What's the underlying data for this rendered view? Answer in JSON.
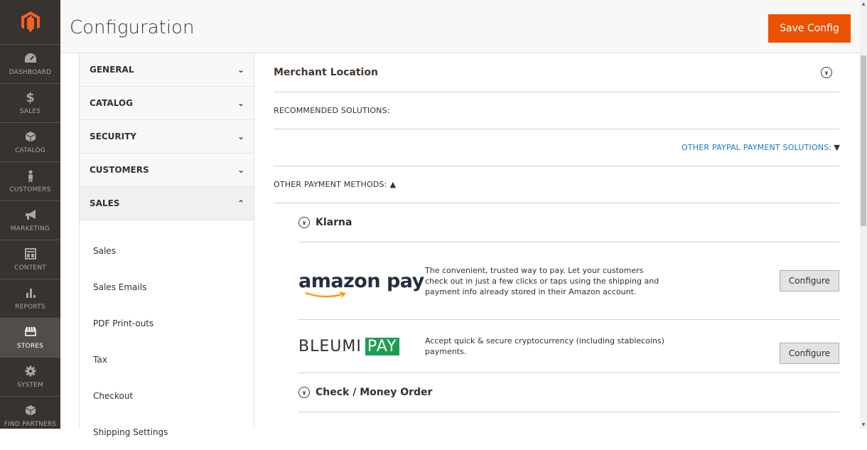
{
  "header": {
    "title": "Configuration",
    "save_label": "Save Config"
  },
  "nav": [
    {
      "label": "DASHBOARD",
      "icon": "dashboard-icon"
    },
    {
      "label": "SALES",
      "icon": "dollar-icon"
    },
    {
      "label": "CATALOG",
      "icon": "box-icon"
    },
    {
      "label": "CUSTOMERS",
      "icon": "person-icon"
    },
    {
      "label": "MARKETING",
      "icon": "megaphone-icon"
    },
    {
      "label": "CONTENT",
      "icon": "layout-icon"
    },
    {
      "label": "REPORTS",
      "icon": "bar-chart-icon"
    },
    {
      "label": "STORES",
      "icon": "storefront-icon"
    },
    {
      "label": "SYSTEM",
      "icon": "gear-icon"
    },
    {
      "label": "FIND PARTNERS",
      "icon": "partners-icon"
    }
  ],
  "tabs": [
    {
      "label": "GENERAL"
    },
    {
      "label": "CATALOG"
    },
    {
      "label": "SECURITY"
    },
    {
      "label": "CUSTOMERS"
    },
    {
      "label": "SALES"
    }
  ],
  "sales_items": [
    "Sales",
    "Sales Emails",
    "PDF Print-outs",
    "Tax",
    "Checkout",
    "Shipping Settings"
  ],
  "main": {
    "merchant_location": "Merchant Location",
    "recommended": "RECOMMENDED SOLUTIONS:",
    "other_paypal": "OTHER PAYPAL PAYMENT SOLUTIONS:",
    "other_methods": "OTHER PAYMENT METHODS:",
    "klarna": "Klarna",
    "amazon": {
      "logo_text": "amazon pay",
      "desc": "The convenient, trusted way to pay. Let your customers check out in just a few clicks or taps using the shipping and payment info already stored in their Amazon account.",
      "button": "Configure"
    },
    "bleumi": {
      "logo_left": "BLEUMI",
      "logo_right": "PAY",
      "desc": "Accept quick & secure cryptocurrency (including stablecoins) payments.",
      "button": "Configure"
    },
    "check_money": "Check / Money Order"
  },
  "colors": {
    "accent": "#eb5202",
    "link": "#1979c3",
    "nav_bg": "#373330",
    "bleumi_green": "#1e9e53",
    "amazon_orange": "#ff9900"
  }
}
